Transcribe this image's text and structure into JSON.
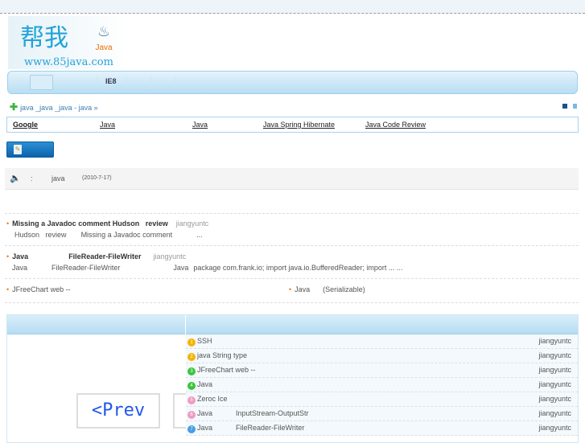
{
  "logo": {
    "chinese": "帮我",
    "java": "Java",
    "url": "www.85java.com"
  },
  "nav": {
    "items": [
      "IE8"
    ]
  },
  "breadcrumb": "java _java _java - java »",
  "links": [
    "Google",
    "Java",
    "Java",
    "Java Spring Hibernate",
    "Java Code Review"
  ],
  "notice": {
    "sep": ":",
    "text": "java",
    "date": "(2010-7-17)"
  },
  "articles": [
    {
      "title_a": "Missing a Javadoc comment Hudson",
      "title_b": "review",
      "author": "jiangyuntc",
      "summary_a": "Hudson",
      "summary_b": "review",
      "summary_c": "Missing a Javadoc comment",
      "summary_d": "..."
    },
    {
      "title_a": "Java",
      "title_b": "FileReader-FileWriter",
      "author": "jiangyuntc",
      "summary_a": "Java",
      "summary_b": "FileReader-FileWriter",
      "summary_c": "Java",
      "summary_d": "package com.frank.io; import java.io.BufferedReader; import ... ..."
    }
  ],
  "related": {
    "left": "JFreeChart  web  --",
    "right_a": "Java",
    "right_b": "(Serializable)"
  },
  "pager": {
    "prev": "<Prev"
  },
  "list": [
    {
      "n": "1",
      "color": "#f5b400",
      "title": "SSH",
      "sub": "",
      "author": "jiangyuntc"
    },
    {
      "n": "2",
      "color": "#f5b400",
      "title": "java String type",
      "sub": "",
      "author": "jiangyuntc"
    },
    {
      "n": "3",
      "color": "#3cc43c",
      "title": "JFreeChart  web  --",
      "sub": "",
      "author": "jiangyuntc"
    },
    {
      "n": "4",
      "color": "#3cc43c",
      "title": "Java",
      "sub": "",
      "author": "jiangyuntc"
    },
    {
      "n": "5",
      "color": "#f29ac0",
      "title": "Zeroc Ice",
      "sub": "",
      "author": "jiangyuntc"
    },
    {
      "n": "6",
      "color": "#f29ac0",
      "title": "Java",
      "sub": "InputStream-OutputStr",
      "author": "jiangyuntc"
    },
    {
      "n": "7",
      "color": "#4a9de0",
      "title": "Java",
      "sub": "FileReader-FileWriter",
      "author": "jiangyuntc"
    }
  ]
}
